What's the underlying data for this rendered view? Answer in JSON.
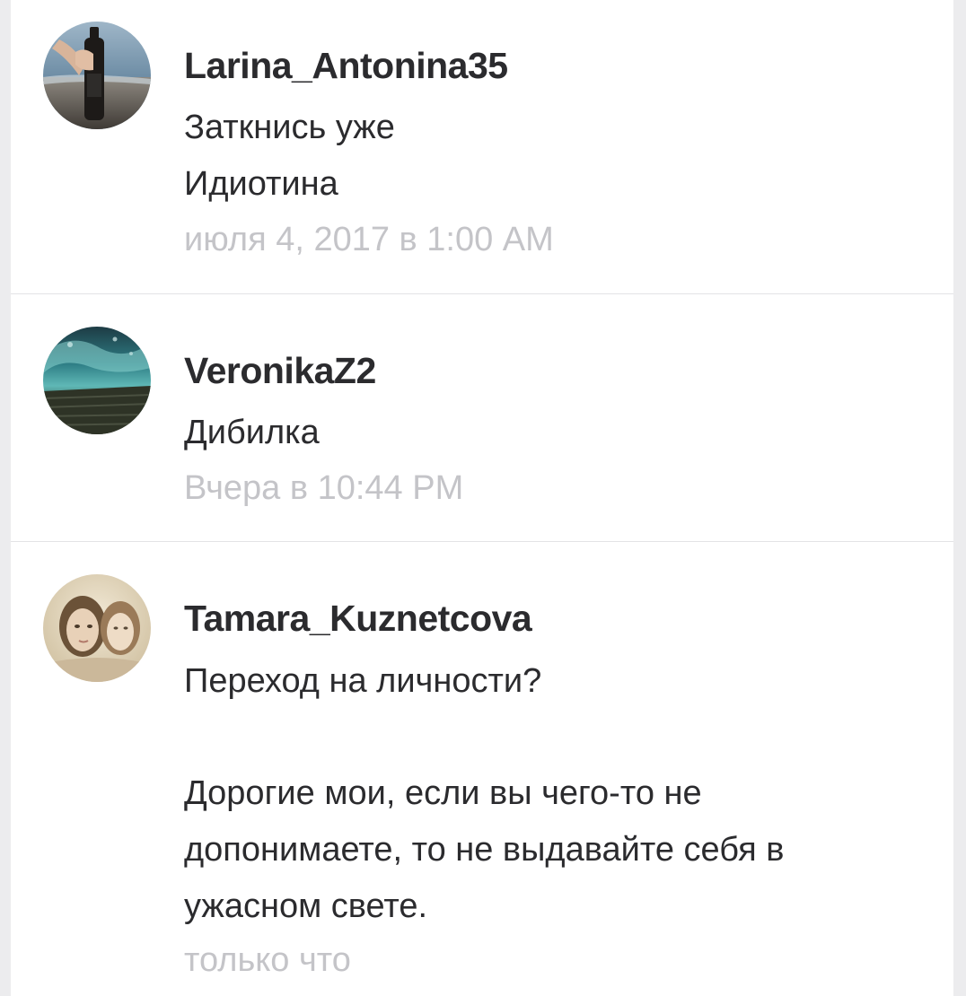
{
  "comments": [
    {
      "username": "Larina_Antonina35",
      "lines": [
        "Заткнись уже",
        "Идиотина"
      ],
      "time": "июля 4, 2017 в 1:00 AM",
      "avatar_icon": "avatar-photo-beach-bottle"
    },
    {
      "username": "VeronikaZ2",
      "lines": [
        "Дибилка"
      ],
      "time": "Вчера в 10:44 PM",
      "avatar_icon": "avatar-photo-ocean-wave"
    },
    {
      "username": "Tamara_Kuznetcova",
      "lines": [
        "Переход на личности?",
        "Дорогие мои, если вы чего-то не",
        "допонимаете, то не выдавайте себя в",
        "ужасном свете."
      ],
      "time": "только что",
      "avatar_icon": "avatar-photo-two-women"
    }
  ],
  "colors": {
    "username": "#2b2b2e",
    "text": "#2b2b2e",
    "timestamp": "#c4c4c8",
    "background": "#ffffff",
    "divider": "#e3e3e6"
  }
}
